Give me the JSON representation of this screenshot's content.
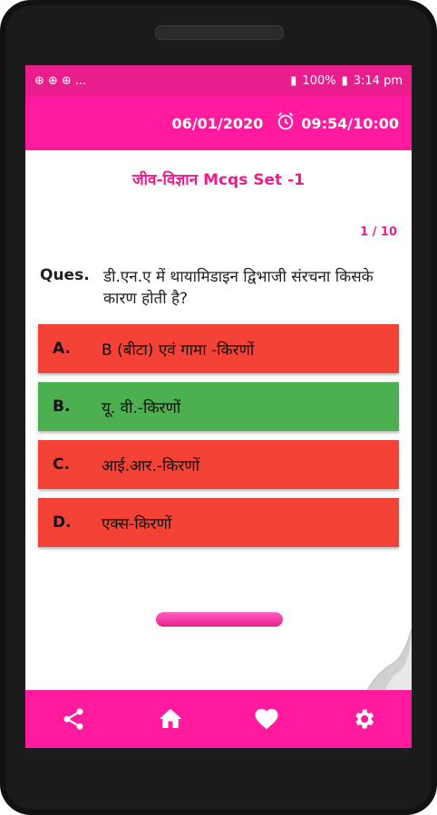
{
  "status_bar": {
    "left_icons": [
      "notification-icon",
      "notification-icon",
      "notification-icon"
    ],
    "left_more": "...",
    "signal": "100%",
    "time": "3:14 pm"
  },
  "header": {
    "date": "06/01/2020",
    "timer": "09:54/10:00"
  },
  "quiz": {
    "title": "जीव-विज्ञान Mcqs Set -1",
    "counter": "1 / 10",
    "question_label": "Ques.",
    "question_text": "डी.एन.ए में थायामिडाइन द्विभाजी संरचना किसके कारण होती है?",
    "options": [
      {
        "letter": "A.",
        "text": "B (बीटा) एवं गामा -किरणों",
        "state": "wrong"
      },
      {
        "letter": "B.",
        "text": "यू. वी.-किरणों",
        "state": "correct"
      },
      {
        "letter": "C.",
        "text": "आई.आर.-किरणों",
        "state": "wrong"
      },
      {
        "letter": "D.",
        "text": "एक्स-किरणों",
        "state": "wrong"
      }
    ]
  },
  "bottom_nav": {
    "items": [
      "share-icon",
      "home-icon",
      "favorite-icon",
      "settings-icon"
    ]
  },
  "colors": {
    "accent": "#e91e8c",
    "wrong": "#f44336",
    "correct": "#4caf50"
  }
}
